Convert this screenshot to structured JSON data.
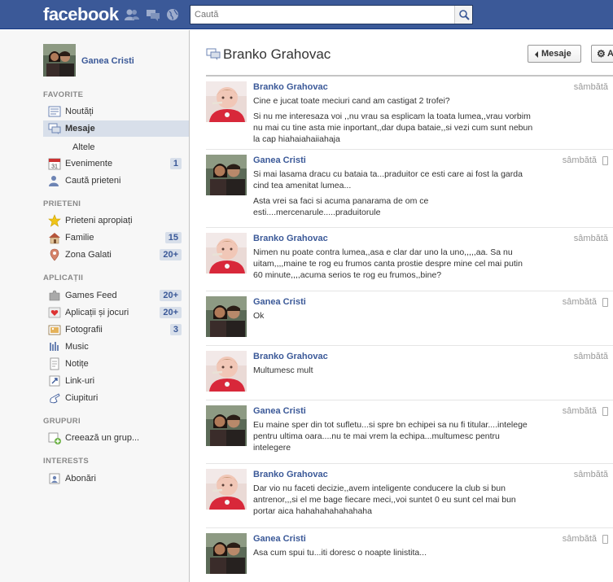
{
  "header": {
    "logo": "facebook",
    "search_placeholder": "Caută"
  },
  "sidebar": {
    "profile_name": "Ganea Cristi",
    "sections": {
      "favorite": "FAVORITE",
      "prieteni": "PRIETENI",
      "aplicatii": "APLICAȚII",
      "grupuri": "GRUPURI",
      "interests": "INTERESTS"
    },
    "favorite_items": [
      {
        "label": "Noutăți",
        "count": ""
      },
      {
        "label": "Mesaje",
        "count": ""
      },
      {
        "label": "Evenimente",
        "count": "1"
      },
      {
        "label": "Caută prieteni",
        "count": ""
      }
    ],
    "mesaje_sub": "Altele",
    "prieteni_items": [
      {
        "label": "Prieteni apropiați",
        "count": ""
      },
      {
        "label": "Familie",
        "count": "15"
      },
      {
        "label": "Zona Galati",
        "count": "20+"
      }
    ],
    "aplicatii_items": [
      {
        "label": "Games Feed",
        "count": "20+"
      },
      {
        "label": "Aplicații și jocuri",
        "count": "20+"
      },
      {
        "label": "Fotografii",
        "count": "3"
      },
      {
        "label": "Music",
        "count": ""
      },
      {
        "label": "Notițe",
        "count": ""
      },
      {
        "label": "Link-uri",
        "count": ""
      },
      {
        "label": "Ciupituri",
        "count": ""
      }
    ],
    "grupuri_items": [
      {
        "label": "Creează un grup..."
      }
    ],
    "interests_items": [
      {
        "label": "Abonări"
      }
    ]
  },
  "thread": {
    "title": "Branko Grahovac",
    "back_button": "Mesaje",
    "actions_button": "A"
  },
  "messages": [
    {
      "author": "Branko Grahovac",
      "time": "sâmbătă",
      "paragraphs": [
        "Cine e jucat toate meciuri cand am castigat 2 trofei?",
        "Si nu me interesaza voi ,,nu vrau sa esplicam la toata lumea,,vrau vorbim nu mai cu tine asta mie inportant,,dar dupa bataie,,si vezi cum sunt nebun la cap hiahaiahaiiahaja"
      ]
    },
    {
      "author": "Ganea Cristi",
      "time": "sâmbătă",
      "paragraphs": [
        "Si mai lasama dracu cu bataia ta...praduitor ce esti care ai fost la garda cind tea amenitat lumea...",
        "Asta vrei sa faci si acuma panarama de om ce esti....mercenarule.....praduitorule"
      ]
    },
    {
      "author": "Branko Grahovac",
      "time": "sâmbătă",
      "paragraphs": [
        "Nimen nu poate contra lumea,,asa e clar dar uno la uno,,,,,aa. Sa nu uitam,,,,maine te rog eu frumos canta prostie despre mine cel mai putin 60 minute,,,,acuma serios te rog eu frumos,,bine?"
      ]
    },
    {
      "author": "Ganea Cristi",
      "time": "sâmbătă",
      "paragraphs": [
        "Ok"
      ]
    },
    {
      "author": "Branko Grahovac",
      "time": "sâmbătă",
      "paragraphs": [
        "Multumesc mult"
      ]
    },
    {
      "author": "Ganea Cristi",
      "time": "sâmbătă",
      "paragraphs": [
        "Eu maine sper din tot sufletu...si spre bn echipei sa nu fi titular....intelege pentru ultima oara....nu te mai vrem la echipa...multumesc pentru intelegere"
      ]
    },
    {
      "author": "Branko Grahovac",
      "time": "sâmbătă",
      "paragraphs": [
        "Dar vio nu faceti decizie,,avem inteligente conducere la club si bun antrenor,,,si el me bage fiecare meci,,voi suntet 0 eu sunt cel mai bun portar aica hahahahahahahaha"
      ]
    },
    {
      "author": "Ganea Cristi",
      "time": "sâmbătă",
      "paragraphs": [
        "Asa cum spui tu...iti doresc o noapte linistita..."
      ]
    }
  ],
  "colors": {
    "brand": "#3b5998",
    "count_bg": "#d8dfea"
  }
}
